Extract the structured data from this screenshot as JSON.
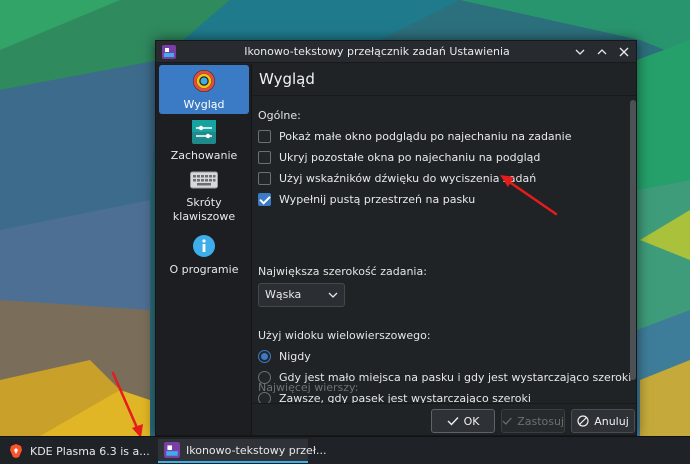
{
  "window": {
    "title": "Ikonowo-tekstowy przełącznik zadań Ustawienia",
    "page_title": "Wygląd"
  },
  "sidebar": {
    "items": [
      {
        "label": "Wygląd",
        "icon": "palette-icon",
        "active": true
      },
      {
        "label": "Zachowanie",
        "icon": "sliders-icon",
        "active": false
      },
      {
        "label": "Skróty klawiszowe",
        "icon": "keyboard-icon",
        "active": false
      },
      {
        "label": "O programie",
        "icon": "info-icon",
        "active": false
      }
    ]
  },
  "general": {
    "label": "Ogólne:",
    "options": [
      {
        "label": "Pokaż małe okno podglądu po najechaniu na zadanie",
        "checked": false
      },
      {
        "label": "Ukryj pozostałe okna po najechaniu na podgląd",
        "checked": false
      },
      {
        "label": "Użyj wskaźników dźwięku do wyciszenia zadań",
        "checked": false
      },
      {
        "label": "Wypełnij pustą przestrzeń na pasku",
        "checked": true
      }
    ]
  },
  "max_width": {
    "label": "Największa szerokość zadania:",
    "selected": "Wąska"
  },
  "multirow": {
    "label": "Użyj widoku wielowierszowego:",
    "options": [
      {
        "label": "Nigdy",
        "checked": true
      },
      {
        "label": "Gdy jest mało miejsca na pasku i gdy jest wystarczająco szeroki",
        "checked": false
      },
      {
        "label": "Zawsze, gdy pasek jest wystarczająco szeroki",
        "checked": false
      }
    ]
  },
  "max_rows": {
    "label": "Najwięcej wierszy:"
  },
  "buttons": {
    "ok": "OK",
    "apply": "Zastosuj",
    "cancel": "Anuluj"
  },
  "taskbar": {
    "task1": "KDE Plasma 6.3 is a...",
    "task2": "Ikonowo-tekstowy przeł..."
  },
  "colors": {
    "accent": "#3b7ac4",
    "annotation": "#e41c1c"
  }
}
